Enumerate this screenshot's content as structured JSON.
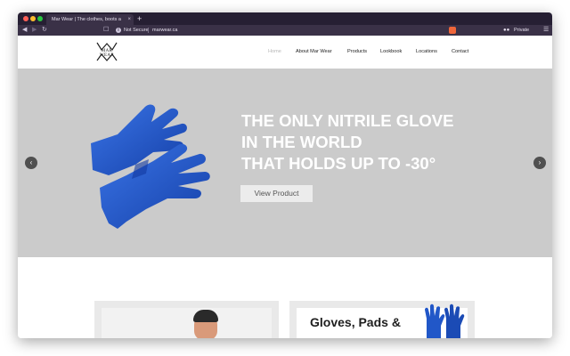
{
  "browser": {
    "tab_title": "Mar Wear | The clothes, boots a",
    "tab_close": "×",
    "new_tab": "+",
    "security_label": "Not Secure",
    "url": "marwear.ca",
    "private_label": "Private",
    "info_glyph": "i"
  },
  "site": {
    "logo_text": "MAR WEAR",
    "nav": [
      {
        "label": "Home",
        "active": true
      },
      {
        "label": "About Mar Wear"
      },
      {
        "label": "Products"
      },
      {
        "label": "Lookbook"
      },
      {
        "label": "Locations"
      },
      {
        "label": "Contact"
      }
    ]
  },
  "hero": {
    "headline_lines": [
      "THE ONLY NITRILE GLOVE",
      "IN THE WORLD",
      "THAT HOLDS UP TO -30°"
    ],
    "cta_label": "View Product",
    "prev_arrow": "‹",
    "next_arrow": "›"
  },
  "cards": {
    "right_title": "Gloves, Pads &"
  },
  "colors": {
    "hero_bg": "#cbcbcb",
    "glove_blue": "#1f56c9",
    "browser_chrome": "#261f33"
  }
}
